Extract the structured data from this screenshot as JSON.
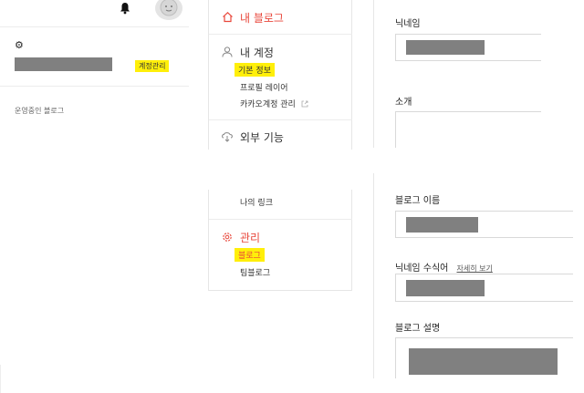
{
  "left": {
    "settings_glyph": "⚙",
    "manage_account_label": "계정관리",
    "operating_blogs_label": "운영중인 블로그",
    "icons": [
      "bell-icon",
      "avatar",
      "gear-icon"
    ]
  },
  "menu_top": {
    "my_blog": "내 블로그",
    "my_account": "내 계정",
    "basic_info": "기본 정보",
    "profile_layer": "프로필 레이어",
    "kakao_account": "카카오계정 관리",
    "external": "외부 기능"
  },
  "menu_bottom": {
    "my_link": "나의 링크",
    "manage": "관리",
    "blog": "블로그",
    "team_blog": "팀블로그"
  },
  "form_top": {
    "nickname_label": "닉네임",
    "intro_label": "소개"
  },
  "form_bottom": {
    "blog_name_label": "블로그 이름",
    "nickname_modifier_label": "닉네임 수식어",
    "see_more_link": "자세히 보기",
    "blog_desc_label": "블로그 설명"
  },
  "colors": {
    "accent_red": "#e8473b",
    "highlight": "#ffef0a",
    "redaction": "#808080"
  }
}
